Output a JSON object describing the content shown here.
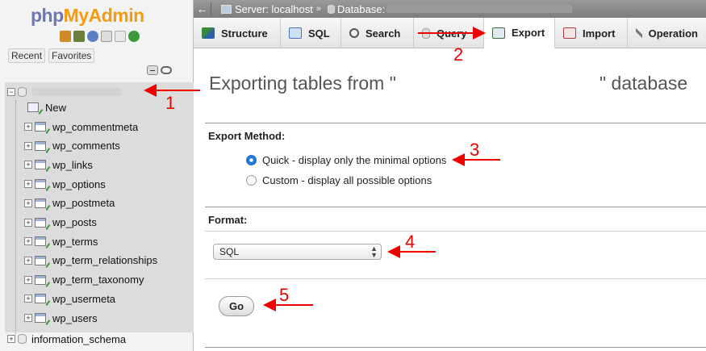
{
  "logo": {
    "php": "php",
    "admin": "MyAdmin"
  },
  "sidebar": {
    "recent_label": "Recent",
    "favorites_label": "Favorites",
    "tree": {
      "new_label": "New",
      "tables": [
        "wp_commentmeta",
        "wp_comments",
        "wp_links",
        "wp_options",
        "wp_postmeta",
        "wp_posts",
        "wp_terms",
        "wp_term_relationships",
        "wp_term_taxonomy",
        "wp_usermeta",
        "wp_users"
      ],
      "other_db": "information_schema"
    }
  },
  "breadcrumb": {
    "server": "Server: localhost",
    "separator": "»",
    "database": "Database:"
  },
  "tabs": [
    {
      "label": "Structure",
      "icon": "structure-icon"
    },
    {
      "label": "SQL",
      "icon": "sql-icon"
    },
    {
      "label": "Search",
      "icon": "search-icon"
    },
    {
      "label": "Query",
      "icon": "query-icon"
    },
    {
      "label": "Export",
      "icon": "export-icon",
      "active": true
    },
    {
      "label": "Import",
      "icon": "import-icon"
    },
    {
      "label": "Operation",
      "icon": "operations-icon"
    }
  ],
  "main": {
    "heading_left": "Exporting tables from \"",
    "heading_right": "\" database",
    "export_method_title": "Export Method:",
    "quick_option": "Quick - display only the minimal options",
    "custom_option": "Custom - display all possible options",
    "format_title": "Format:",
    "format_value": "SQL",
    "go_label": "Go"
  },
  "annotations": [
    "1",
    "2",
    "3",
    "4",
    "5"
  ],
  "colors": {
    "annotation": "#e00000",
    "logo_php": "#6c78af",
    "logo_admin": "#f39c12",
    "radio_accent": "#1f7bd8"
  }
}
